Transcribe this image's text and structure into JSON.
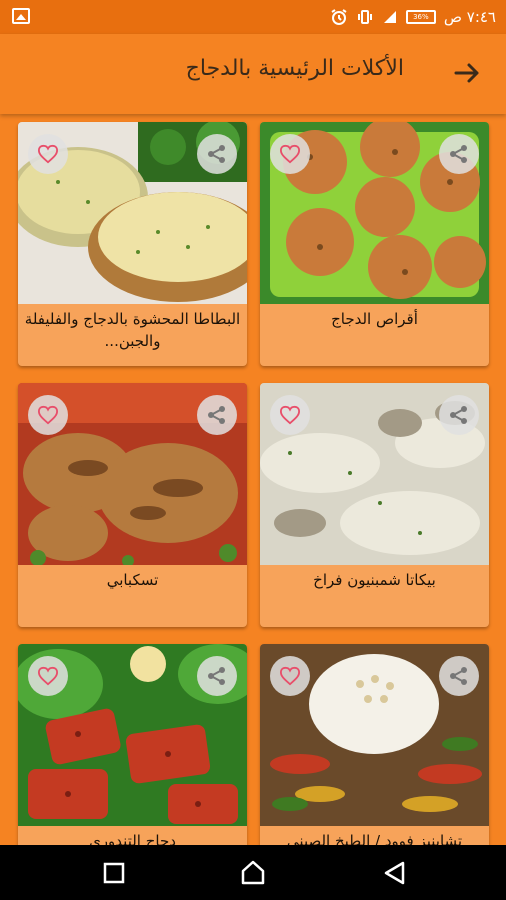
{
  "status_bar": {
    "time": "٧:٤٦ ص",
    "battery_label": "36%",
    "icons": [
      "gallery-icon",
      "alarm-icon",
      "vibrate-icon",
      "signal-icon"
    ]
  },
  "app_bar": {
    "title": "الأكلات الرئيسية بالدجاج",
    "back_icon": "arrow-right-icon"
  },
  "colors": {
    "primary": "#f58322",
    "status_bar": "#e86f0f",
    "card": "#f7a35a",
    "heart": "#e84e6a"
  },
  "recipes": [
    {
      "title": "البطاطا المحشوة بالدجاج والفليفلة والجبن...",
      "photo": "stuffed-potatoes"
    },
    {
      "title": "أقراص الدجاج",
      "photo": "chicken-patties"
    },
    {
      "title": "تسكبابي",
      "photo": "grilled-chicken"
    },
    {
      "title": "بيكاتا شمبنيون فراخ",
      "photo": "chicken-mushroom-cream"
    },
    {
      "title": "دجاج التندوري",
      "photo": "tandoori-chicken"
    },
    {
      "title": "تشاينيز فوود / الطبخ الصيني",
      "photo": "chinese-rice-chicken"
    }
  ]
}
